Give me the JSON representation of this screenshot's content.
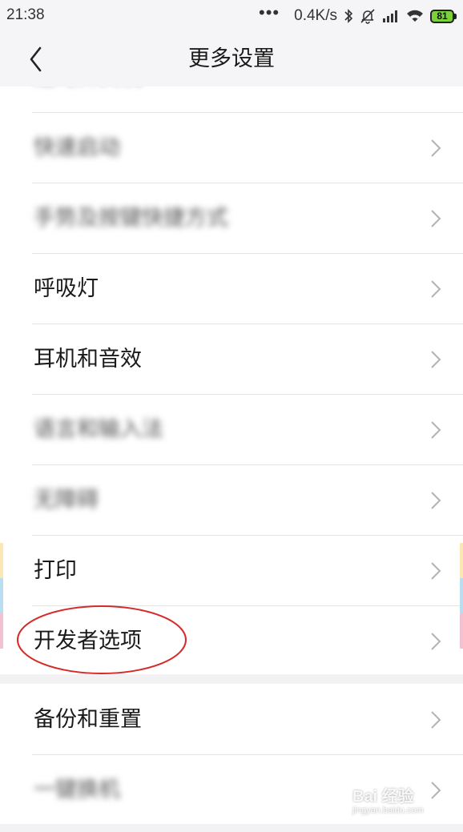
{
  "status_bar": {
    "time": "21:38",
    "dots": "•••",
    "net_speed": "0.4K/s",
    "battery": "81"
  },
  "nav": {
    "title": "更多设置"
  },
  "items": [
    {
      "label": "定时开关机",
      "blurred": true
    },
    {
      "label": "快速启动",
      "blurred": true
    },
    {
      "label": "手势及按键快捷方式",
      "blurred": true
    },
    {
      "label": "呼吸灯",
      "blurred": false
    },
    {
      "label": "耳机和音效",
      "blurred": false
    },
    {
      "label": "语言和输入法",
      "blurred": true
    },
    {
      "label": "无障碍",
      "blurred": true
    },
    {
      "label": "打印",
      "blurred": false
    },
    {
      "label": "开发者选项",
      "blurred": false
    },
    {
      "label": "备份和重置",
      "blurred": false
    },
    {
      "label": "一键换机",
      "blurred": true
    }
  ],
  "annotation": {
    "ellipse_color": "#d42a2a"
  },
  "watermark": {
    "brand": "Bai 经验",
    "url": "jingyan.baidu.com"
  },
  "colors": {
    "background": "#f2f2f4",
    "card": "#ffffff",
    "divider": "#e4e4e6",
    "chevron": "#b3b3b3",
    "edge_yellow": "#fbe7b4",
    "edge_blue": "#b9def2",
    "edge_pink": "#f2c2d2"
  }
}
